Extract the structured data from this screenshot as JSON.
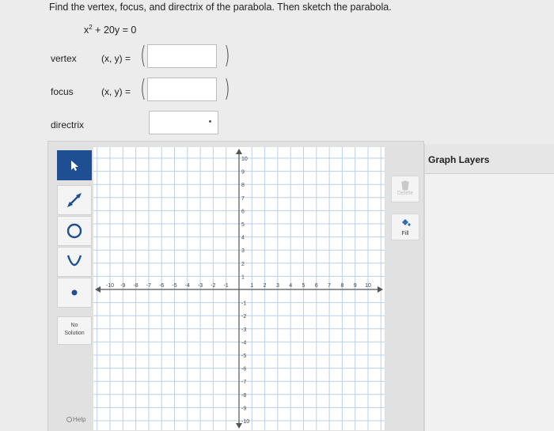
{
  "question": {
    "prompt": "Find the vertex, focus, and directrix of the parabola. Then sketch the parabola.",
    "equation_prefix": "x",
    "equation_exp": "2",
    "equation_suffix": " + 20y = 0"
  },
  "fields": {
    "vertex_label": "vertex",
    "focus_label": "focus",
    "directrix_label": "directrix",
    "xy_label": "(x, y) =",
    "open_paren": "(",
    "close_paren": ")",
    "vertex_value": "",
    "focus_value": "",
    "directrix_value": ""
  },
  "toolbar": {
    "tools": [
      "pointer-icon",
      "line-icon",
      "circle-icon",
      "parabola-icon",
      "point-icon"
    ],
    "no_solution_line1": "No",
    "no_solution_line2": "Solution",
    "help": "Help",
    "accent_color": "#1e4f93"
  },
  "graph": {
    "x_range": [
      -10,
      10
    ],
    "y_range": [
      -10,
      10
    ],
    "grid": true,
    "x_tick_labels": [
      "-10",
      "-9",
      "-8",
      "-7",
      "-6",
      "-5",
      "-4",
      "-3",
      "-2",
      "-1",
      "1",
      "2",
      "3",
      "4",
      "5",
      "6",
      "7",
      "8",
      "9",
      "10"
    ],
    "y_tick_labels": [
      "10",
      "9",
      "8",
      "7",
      "6",
      "5",
      "4",
      "3",
      "2",
      "1",
      "-1",
      "-2",
      "-3",
      "-4",
      "-5",
      "-6",
      "-7",
      "-8",
      "-9",
      "-10"
    ]
  },
  "side": {
    "delete_label": "Delete",
    "fill_label": "Fill",
    "layers_title": "Graph Layers"
  }
}
